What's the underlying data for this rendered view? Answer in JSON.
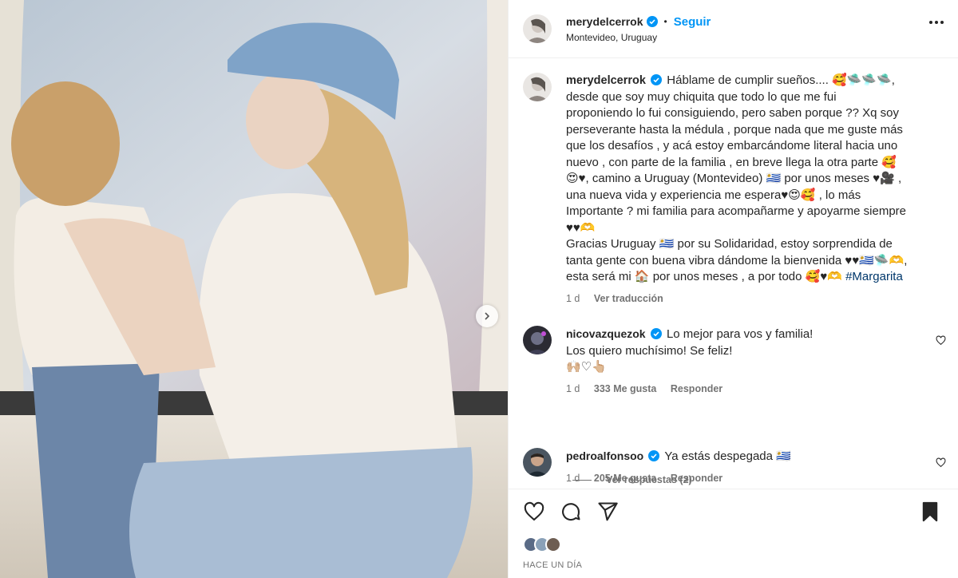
{
  "post": {
    "author": {
      "username": "merydelcerrok",
      "follow_label": "Seguir",
      "separator": "•",
      "location": "Montevideo, Uruguay"
    },
    "caption": {
      "username": "merydelcerrok",
      "text_lines": [
        "Háblame de cumplir sueños.... 🥰🛸🛸🛸,",
        "desde que soy muy chiquita que todo lo que me fui",
        "proponiendo lo fui consiguiendo, pero saben porque ?? Xq soy",
        "perseverante hasta la médula , porque nada que me guste más",
        "que los desafíos , y acá estoy embarcándome literal hacia uno",
        "nuevo , con parte de la familia , en breve llega la otra parte 🥰",
        "😍♥, camino a Uruguay (Montevideo) 🇺🇾 por unos meses ♥🎥 ,",
        "una nueva vida y experiencia me espera♥😍🥰 , lo más",
        "Importante ? mi familia para acompañarme y apoyarme siempre",
        "♥♥🫶",
        "Gracias Uruguay 🇺🇾 por su Solidaridad, estoy sorprendida de",
        "tanta gente con buena vibra dándome la bienvenida ♥♥🇺🇾🛸🫶,",
        "esta será mi 🏠 por unos meses , a por todo 🥰♥🫶"
      ],
      "hashtag": "#Margarita",
      "time": "1 d",
      "translate_label": "Ver traducción"
    },
    "comments": [
      {
        "username": "nicovazquezok",
        "text_lines": [
          "Lo mejor para vos y familia!",
          "Los quiero muchísimo! Se feliz!",
          "🙌🏼♡👆🏼"
        ],
        "time": "1 d",
        "likes": "333 Me gusta",
        "reply_label": "Responder",
        "view_replies": "Ver respuestas (2)"
      },
      {
        "username": "pedroalfonsoo",
        "text_lines": [
          "Ya estás despegada 🇺🇾"
        ],
        "time": "1 d",
        "likes": "205 Me gusta",
        "reply_label": "Responder"
      }
    ],
    "timestamp": "HACE UN DÍA"
  },
  "colors": {
    "accent": "#0095f6",
    "verified": "#0095f6",
    "text": "#262626",
    "muted": "#737373",
    "hashtag": "#00376b"
  },
  "icons": [
    "verified-badge-icon",
    "more-options-icon",
    "heart-icon",
    "comment-icon",
    "share-icon",
    "bookmark-icon",
    "next-arrow-icon"
  ]
}
